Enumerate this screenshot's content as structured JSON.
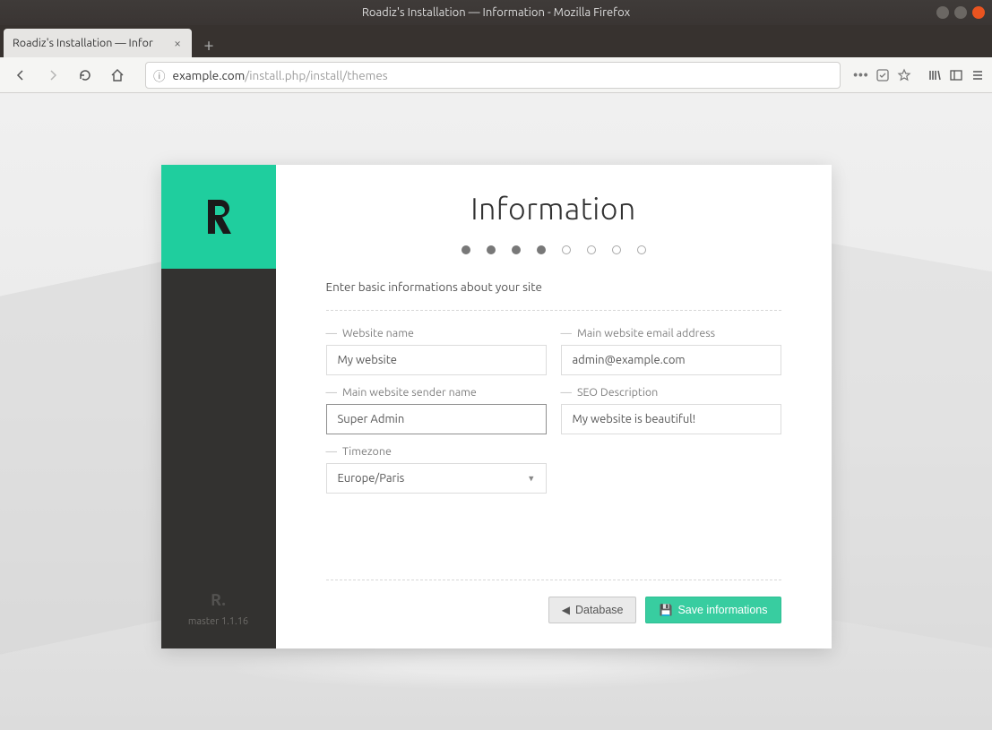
{
  "window": {
    "title": "Roadiz's Installation — Information - Mozilla Firefox"
  },
  "tab": {
    "title": "Roadiz's Installation — Infor"
  },
  "address": {
    "host": "example.com",
    "path": "/install.php/install/themes"
  },
  "sidebar": {
    "version": "master 1.1.16"
  },
  "panel": {
    "title": "Information",
    "steps_done": 4,
    "steps_total": 8,
    "intro": "Enter basic informations about your site"
  },
  "fields": {
    "website_name": {
      "label": "Website name",
      "value": "My website"
    },
    "email": {
      "label": "Main website email address",
      "value": "admin@example.com"
    },
    "sender": {
      "label": "Main website sender name",
      "value": "Super Admin"
    },
    "seo": {
      "label": "SEO Description",
      "value": "My website is beautiful!"
    },
    "timezone": {
      "label": "Timezone",
      "value": "Europe/Paris"
    }
  },
  "buttons": {
    "back": "Database",
    "save": "Save informations"
  }
}
